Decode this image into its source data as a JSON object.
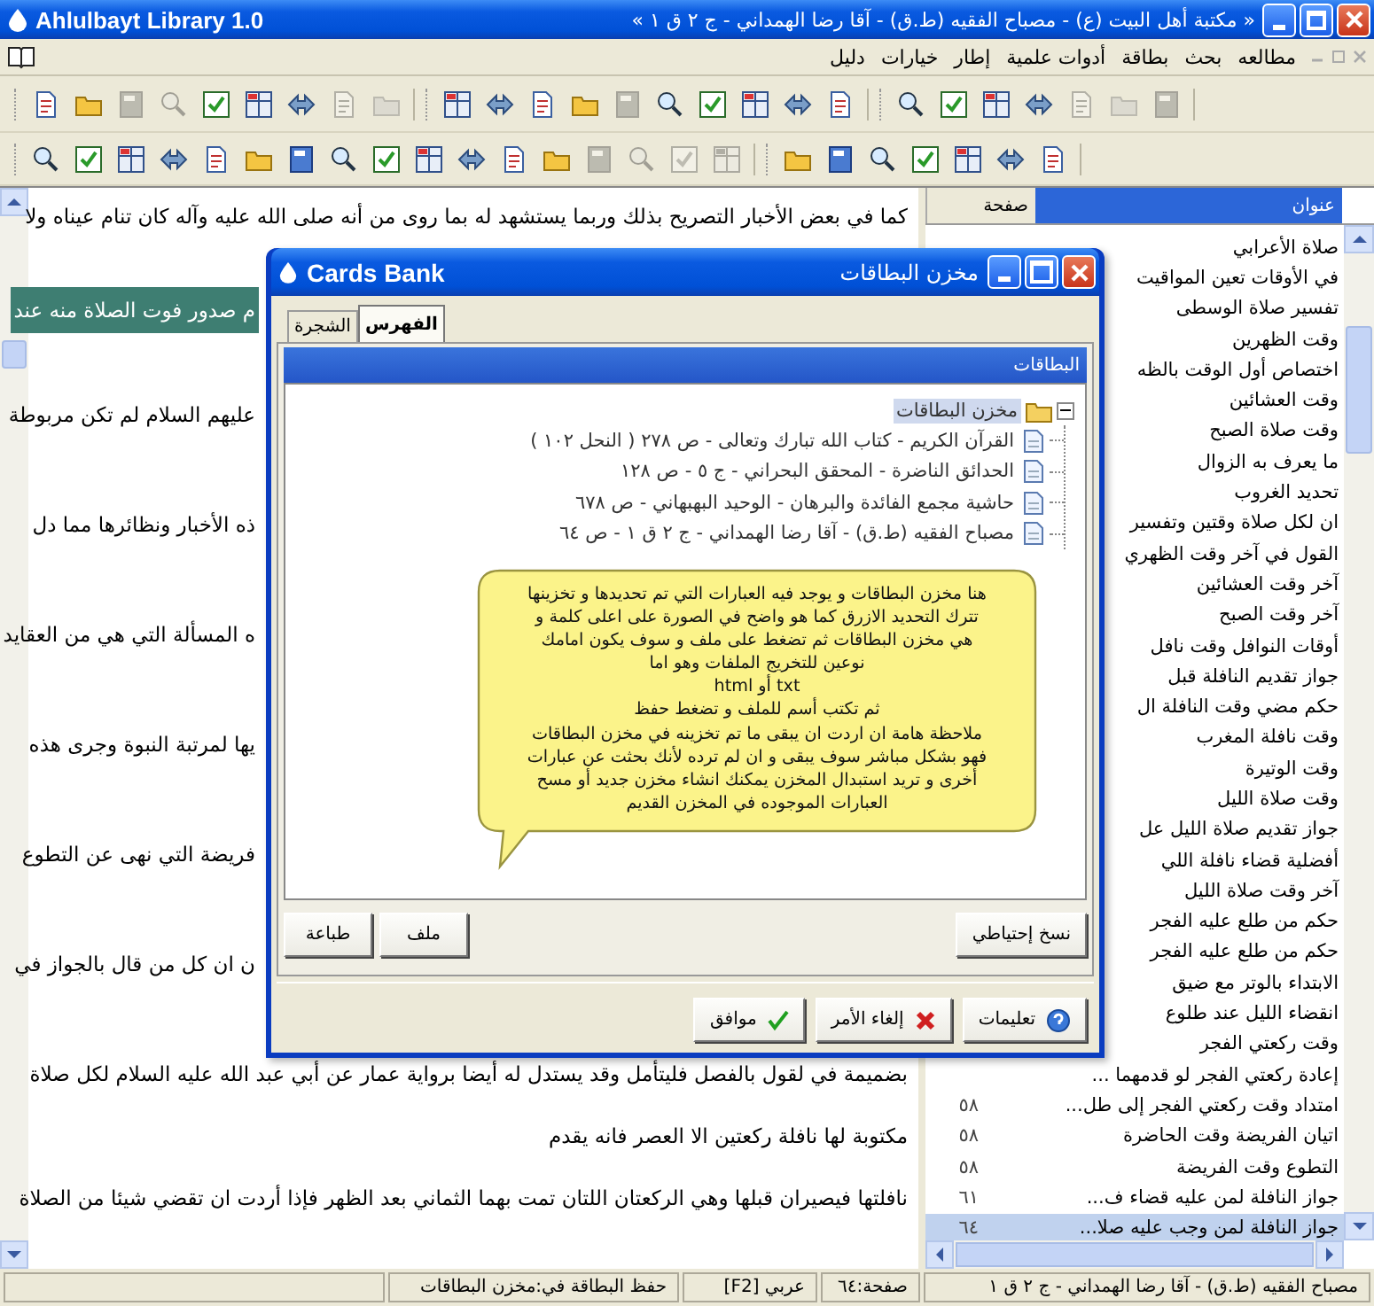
{
  "window": {
    "title": "Ahlulbayt Library 1.0",
    "document_title": "« مكتبة أهل البيت (ع) - مصباح الفقيه (ط.ق) - آقا رضا الهمداني - ج ٢ ق ١ »"
  },
  "menu": [
    "مطالعه",
    "بحث",
    "بطاقة",
    "أدوات علمية",
    "إطار",
    "خيارات",
    "دليل"
  ],
  "toolbars": [
    [
      [
        {
          "disabled": false
        },
        {
          "disabled": false
        },
        {
          "disabled": true
        },
        {
          "disabled": true
        },
        {
          "disabled": false
        },
        {
          "disabled": false
        },
        {
          "disabled": false
        },
        {
          "disabled": true
        },
        {
          "disabled": true
        }
      ],
      [
        {
          "disabled": false
        },
        {
          "disabled": false
        },
        {
          "disabled": false
        },
        {
          "disabled": false
        },
        {
          "disabled": true
        },
        {
          "disabled": false
        },
        {
          "disabled": false
        },
        {
          "disabled": false
        },
        {
          "disabled": false
        },
        {
          "disabled": false
        }
      ],
      [
        {
          "disabled": false
        },
        {
          "disabled": false
        },
        {
          "disabled": false
        },
        {
          "disabled": false
        },
        {
          "disabled": true
        },
        {
          "disabled": true
        },
        {
          "disabled": true
        }
      ]
    ],
    [
      [
        {
          "disabled": false
        },
        {
          "disabled": false
        },
        {
          "disabled": false
        },
        {
          "disabled": false
        },
        {
          "disabled": false
        },
        {
          "disabled": false
        },
        {
          "disabled": false
        },
        {
          "disabled": false
        },
        {
          "disabled": false
        },
        {
          "disabled": false
        },
        {
          "disabled": false
        },
        {
          "disabled": false
        },
        {
          "disabled": false
        },
        {
          "disabled": true
        },
        {
          "disabled": true
        },
        {
          "disabled": true
        },
        {
          "disabled": true
        }
      ],
      [
        {
          "disabled": false
        },
        {
          "disabled": false
        },
        {
          "disabled": false
        },
        {
          "disabled": false
        },
        {
          "disabled": false
        },
        {
          "disabled": false
        },
        {
          "disabled": false
        }
      ]
    ]
  ],
  "text_pane": {
    "lines_above_dialog": [
      {
        "text": "كما في بعض الأخبار التصريح بذلك وربما يستشهد له بما روى من أنه صلى الله عليه وآله كان تنام عيناه ولا",
        "selected": false
      }
    ],
    "lines_beside_dialog": [
      {
        "text": "م صدور فوت الصلاة منه عند",
        "selected": true
      },
      {
        "text": "عليهم السلام لم تكن مربوطة",
        "selected": false
      },
      {
        "text": "ذه الأخبار ونظائرها مما دل",
        "selected": false
      },
      {
        "text": "ه المسألة التي هي من العقايد",
        "selected": false
      },
      {
        "text": "يها لمرتبة النبوة وجرى هذه",
        "selected": false
      },
      {
        "text": "فريضة التي نهى عن التطوع",
        "selected": false
      },
      {
        "text": "ن ان كل من قال بالجواز في",
        "selected": false
      }
    ],
    "lines_below_dialog": [
      {
        "text": "بضميمة في لقول بالفصل فليتأمل وقد يستدل له أيضا برواية عمار عن أبي عبد الله عليه السلام لكل صلاة",
        "selected": false
      },
      {
        "text": "مكتوبة لها نافلة ركعتين الا العصر فانه يقدم",
        "selected": false
      },
      {
        "text": "نافلتها فيصيران قبلها وهي الركعتان اللتان تمت بهما الثماني بعد الظهر فإذا أردت ان تقضي شيئا من الصلاة",
        "selected": false
      }
    ]
  },
  "contents_pane": {
    "columns": [
      "عنوان",
      "صفحة"
    ],
    "rows": [
      {
        "title": "صلاة الأعرابي",
        "selected": false
      },
      {
        "title": "في الأوقات تعين المواقيت",
        "selected": false
      },
      {
        "title": "تفسير صلاة الوسطى",
        "selected": false
      },
      {
        "title": "وقت الظهرين",
        "selected": false
      },
      {
        "title": "اختصاص أول الوقت بالظه",
        "selected": false
      },
      {
        "title": "وقت العشائين",
        "selected": false
      },
      {
        "title": "وقت صلاة الصبح",
        "selected": false
      },
      {
        "title": "ما يعرف به الزوال",
        "selected": false
      },
      {
        "title": "تحديد الغروب",
        "selected": false
      },
      {
        "title": "ان لكل صلاة وقتين وتفسير",
        "selected": false
      },
      {
        "title": "القول في آخر وقت الظهري",
        "selected": false
      },
      {
        "title": "آخر وقت العشائين",
        "selected": false
      },
      {
        "title": "آخر وقت الصبح",
        "selected": false
      },
      {
        "title": "أوقات النوافل وقت نافل",
        "selected": false
      },
      {
        "title": "جواز تقديم النافلة قبل",
        "selected": false
      },
      {
        "title": "حكم مضي وقت النافلة ال",
        "selected": false
      },
      {
        "title": "وقت نافلة المغرب",
        "selected": false
      },
      {
        "title": "وقت الوتيرة",
        "selected": false
      },
      {
        "title": "وقت صلاة الليل",
        "selected": false
      },
      {
        "title": "جواز تقديم صلاة الليل عل",
        "selected": false
      },
      {
        "title": "أفضلية قضاء نافلة اللي",
        "selected": false
      },
      {
        "title": "آخر وقت صلاة الليل",
        "selected": false
      },
      {
        "title": "حكم من طلع عليه الفجر",
        "selected": false
      },
      {
        "title": "حكم من طلع عليه الفجر",
        "selected": false
      },
      {
        "title": "الابتداء بالوتر مع ضيق",
        "selected": false
      },
      {
        "title": "انقضاء الليل عند طلوع",
        "selected": false
      },
      {
        "title": "وقت ركعتي الفجر",
        "selected": false
      },
      {
        "title": "إعادة ركعتي الفجر لو قدمهما ...",
        "selected": false
      },
      {
        "title": "امتداد وقت ركعتي الفجر إلى طل...",
        "page": "٥٨",
        "selected": false
      },
      {
        "title": "اتيان الفريضة وقت الحاضرة",
        "page": "٥٨",
        "selected": false
      },
      {
        "title": "التطوع وقت الفريضة",
        "page": "٥٨",
        "selected": false
      },
      {
        "title": "جواز النافلة لمن عليه قضاء ف...",
        "page": "٦١",
        "selected": false
      },
      {
        "title": "جواز النافلة لمن وجب عليه صلا...",
        "page": "٦٤",
        "selected": true
      }
    ]
  },
  "dialog": {
    "title": "Cards Bank",
    "title_ar": "مخزن البطاقات",
    "tabs": [
      {
        "label": "الفهرس",
        "selected": true
      },
      {
        "label": "الشجرة",
        "selected": false
      }
    ],
    "panel_title": "البطاقات",
    "tree": {
      "label": "مخزن البطاقات",
      "expanded": true,
      "selected": true,
      "children": [
        {
          "label": "القرآن الكريم - كتاب الله تبارك وتعالى - ص ٢٧٨ ( النحل ١٠٢ )"
        },
        {
          "label": "الحدائق الناضرة - المحقق البحراني - ج ٥ - ص ١٢٨"
        },
        {
          "label": "حاشية مجمع الفائدة والبرهان - الوحيد البهبهاني - ص ٦٧٨"
        },
        {
          "label": "مصباح الفقيه (ط.ق) - آقا رضا الهمداني - ج ٢ ق ١ - ص ٦٤"
        }
      ]
    },
    "callout": [
      "هنا مخزن البطاقات و يوجد فيه العبارات التي تم تحديدها و تخزينها",
      "تترك التحديد الازرق كما هو واضح في الصورة على اعلى كلمة و",
      "هي مخزن البطاقات ثم تضغط على ملف و سوف يكون امامك",
      "نوعين للتخريج الملفات وهو اما",
      "txt أو html",
      "ثم تكتب أسم للملف و تضغط حفظ",
      "ملاحظة هامة ان اردت ان يبقى ما تم تخزينه في مخزن البطاقات",
      "فهو بشكل مباشر سوف يبقى و ان لم ترده لأنك بحثت عن عبارات",
      "أخرى و تريد استبدال المخزن يمكنك انشاء مخزن جديد أو مسح",
      "العبارات الموجوده في المخزن القديم"
    ],
    "panel_buttons_left": [
      "ملف",
      "طباعة"
    ],
    "panel_buttons_right": [
      "نسخ إحتياطي"
    ],
    "footer_buttons": [
      {
        "label": "تعليمات",
        "kind": "help"
      },
      {
        "label": "إلغاء الأمر",
        "kind": "cancel"
      },
      {
        "label": "موافق",
        "kind": "ok"
      }
    ]
  },
  "status_bar": [
    "مصباح الفقيه (ط.ق) - آقا رضا الهمداني - ج ٢ ق ١",
    "صفحة:٦٤",
    "عربي [F2]",
    "حفظ البطاقة في:مخزن البطاقات"
  ]
}
